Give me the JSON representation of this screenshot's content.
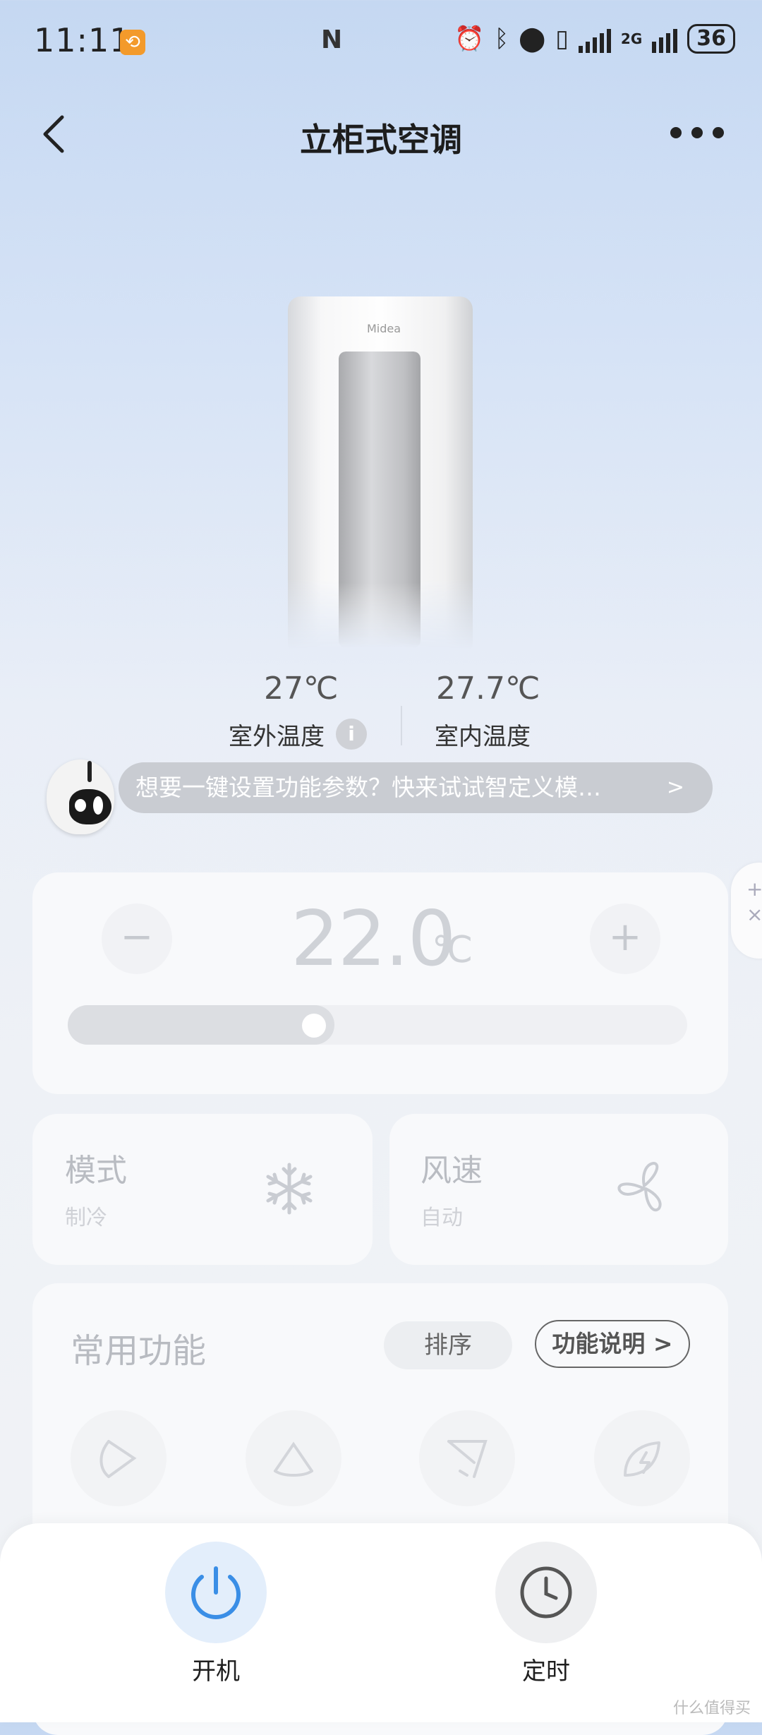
{
  "status_bar": {
    "time": "11:11",
    "app_badge_icon": "orange-app-icon",
    "nfc_icon": "N",
    "signal_label": "2G",
    "battery": "36"
  },
  "header": {
    "title": "立柜式空调"
  },
  "device": {
    "logo_text": "Midea",
    "outdoor_temp": "27℃",
    "outdoor_label": "室外温度",
    "indoor_temp": "27.7℃",
    "indoor_label": "室内温度"
  },
  "assistant": {
    "message": "想要一键设置功能参数？快来试试智定义模…",
    "arrow": ">"
  },
  "temperature": {
    "minus": "−",
    "plus": "+",
    "value": "22.0",
    "unit": "℃",
    "slider_fraction": 0.43
  },
  "side_fab": {
    "plus": "+",
    "close": "×"
  },
  "mode": {
    "title": "模式",
    "value": "制冷",
    "icon": "snowflake-icon"
  },
  "fan": {
    "title": "风速",
    "value": "自动",
    "icon": "fan-icon"
  },
  "functions": {
    "title": "常用功能",
    "sort_label": "排序",
    "help_label": "功能说明",
    "help_arrow": ">"
  },
  "bottom": {
    "power_label": "开机",
    "timer_label": "定时"
  },
  "watermark": "什么值得买",
  "colors": {
    "power_blue": "#3a8ee6",
    "card_bg": "#f8f9fb"
  }
}
